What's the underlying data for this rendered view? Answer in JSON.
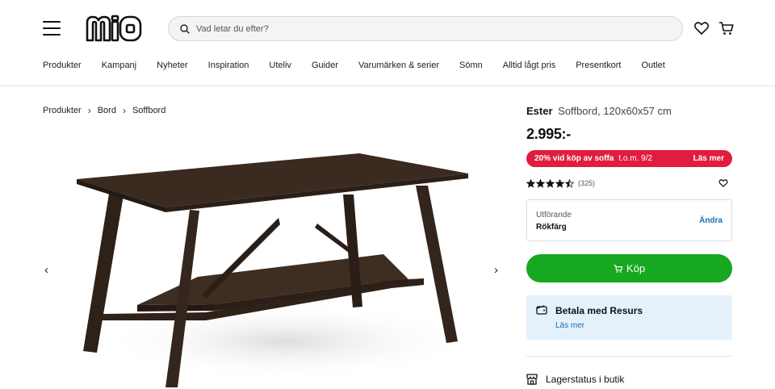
{
  "header": {
    "search_placeholder": "Vad letar du efter?"
  },
  "nav": {
    "items": [
      "Produkter",
      "Kampanj",
      "Nyheter",
      "Inspiration",
      "Uteliv",
      "Guider",
      "Varumärken & serier",
      "Sömn",
      "Alltid lågt pris",
      "Presentkort",
      "Outlet"
    ]
  },
  "breadcrumb": {
    "items": [
      "Produkter",
      "Bord",
      "Soffbord"
    ]
  },
  "product": {
    "brand": "Ester",
    "description": "Soffbord, 120x60x57 cm",
    "price": "2.995:-",
    "promo": {
      "text": "20% vid köp av soffa",
      "date": "t.o.m. 9/2",
      "link": "Läs mer",
      "color": "#e11d3f"
    },
    "rating": {
      "stars": 4.5,
      "max": 5,
      "count": "(325)"
    },
    "variant": {
      "label": "Utförande",
      "value": "Rökfärg",
      "change": "Ändra"
    },
    "buy_label": "Köp",
    "buy_color": "#16a820",
    "payment": {
      "title": "Betala med Resurs",
      "link": "Läs mer"
    },
    "stock_label": "Lagerstatus i butik"
  },
  "icons": {
    "menu": "hamburger-menu-icon",
    "search": "search-icon",
    "wishlist": "heart-icon",
    "cart": "cart-icon",
    "prev": "chevron-left-icon",
    "next": "chevron-right-icon",
    "wallet": "wallet-icon",
    "store": "store-icon"
  }
}
